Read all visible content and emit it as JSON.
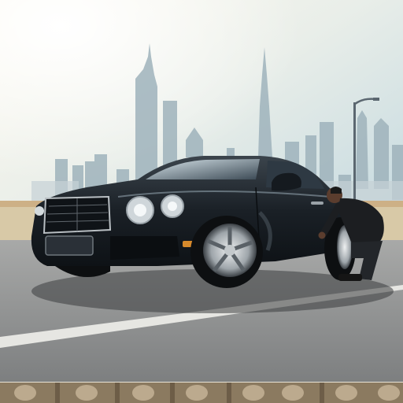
{
  "scene": {
    "subject": "black-luxury-coupe",
    "background": "city-skyline-haze",
    "person": "man-in-black-crouching-at-rear-wheel",
    "colors": {
      "sky_top": "#cfe0e6",
      "sky_glow": "#fbf6e8",
      "car_body": "#1d2329",
      "road": "#8d8f90",
      "barrier": "#d9caa9"
    }
  },
  "car": {
    "plate_text": ""
  }
}
